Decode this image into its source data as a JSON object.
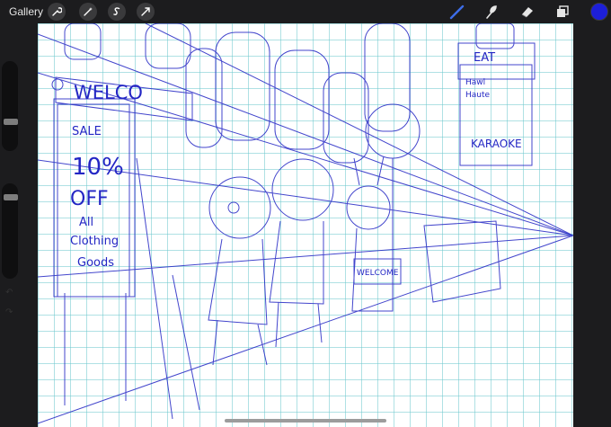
{
  "toolbar": {
    "gallery_label": "Gallery",
    "left_tools": [
      "wrench-icon",
      "magic-wand-icon",
      "selection-icon",
      "transform-arrow-icon"
    ],
    "right_tools": [
      "brush-icon",
      "smudge-icon",
      "eraser-icon",
      "layers-icon"
    ],
    "active_color": "#1d1fd8"
  },
  "sidebar": {
    "brush_size_level": 0.5,
    "opacity_level": 0.5
  },
  "canvas": {
    "grid_color": "#6ec8cd",
    "ink_color": "#2326c4",
    "signs": {
      "welcome_banner": "WELCO",
      "sale_sign": [
        "SALE",
        "10%",
        "OFF",
        "All",
        "Clothing",
        "Goods"
      ],
      "shop_sign_top": "EAT",
      "menu_sign": [
        "Hawl",
        "Haute"
      ],
      "karaoke_sign": "KARAOKE",
      "welcome_board": "WELCOME"
    }
  }
}
